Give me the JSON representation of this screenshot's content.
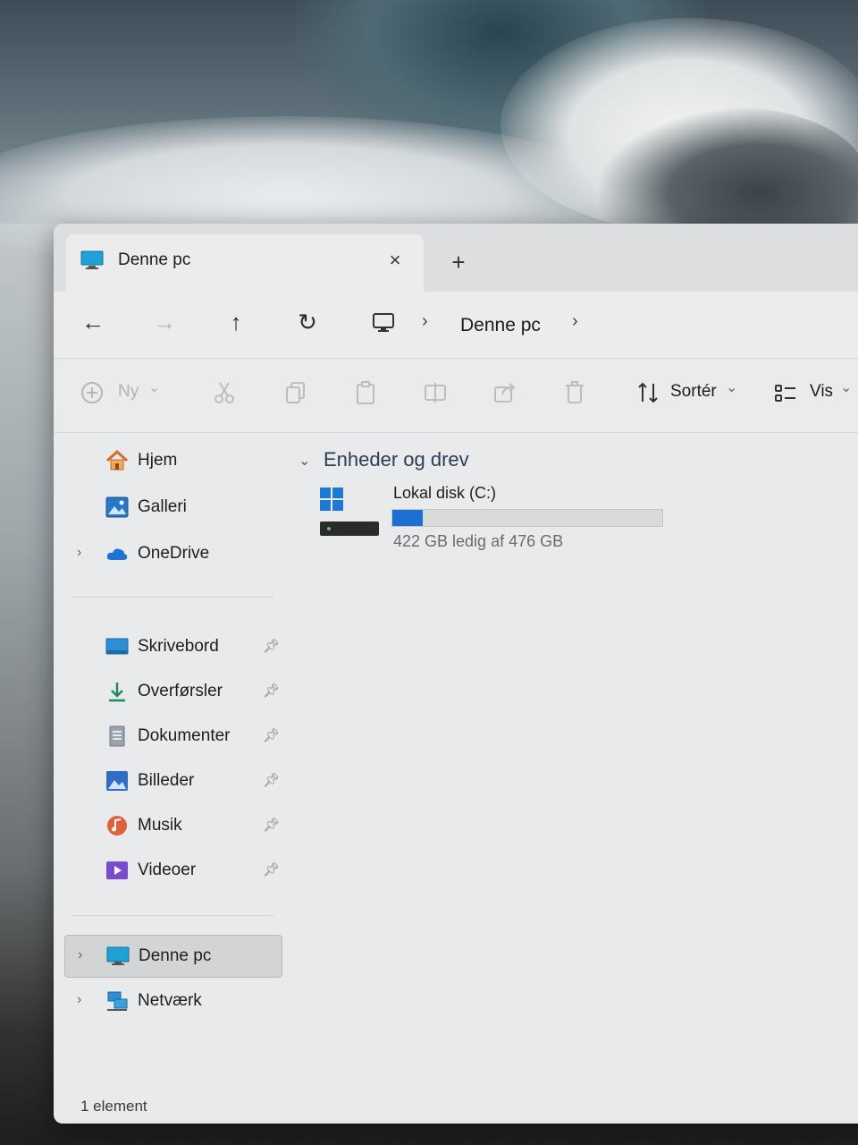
{
  "window": {
    "tab_title": "Denne pc",
    "tab_close": "×",
    "new_tab": "+"
  },
  "nav": {
    "back": "←",
    "forward": "→",
    "up": "↑",
    "refresh": "↻",
    "sep": "›",
    "breadcrumb": "Denne pc"
  },
  "toolbar": {
    "new_label": "Ny",
    "sort_label": "Sortér",
    "view_label": "Vis",
    "caret": "⌄"
  },
  "sidebar": {
    "quick": [
      {
        "label": "Hjem",
        "icon": "home-icon"
      },
      {
        "label": "Galleri",
        "icon": "gallery-icon"
      },
      {
        "label": "OneDrive",
        "icon": "cloud-icon"
      }
    ],
    "pinned": [
      {
        "label": "Skrivebord",
        "icon": "desktop-icon"
      },
      {
        "label": "Overførsler",
        "icon": "download-icon"
      },
      {
        "label": "Dokumenter",
        "icon": "document-icon"
      },
      {
        "label": "Billeder",
        "icon": "pictures-icon"
      },
      {
        "label": "Musik",
        "icon": "music-icon"
      },
      {
        "label": "Videoer",
        "icon": "video-icon"
      }
    ],
    "locations": [
      {
        "label": "Denne pc",
        "icon": "pc-icon"
      },
      {
        "label": "Netværk",
        "icon": "network-icon"
      }
    ]
  },
  "content": {
    "group_title": "Enheder og drev",
    "drive": {
      "name": "Lokal disk (C:)",
      "free_text": "422 GB ledig af 476 GB",
      "used_fraction": 0.113
    }
  },
  "status": {
    "count": "1 element"
  },
  "colors": {
    "accent": "#1e70d0",
    "window_bg": "#e9eaeb"
  }
}
